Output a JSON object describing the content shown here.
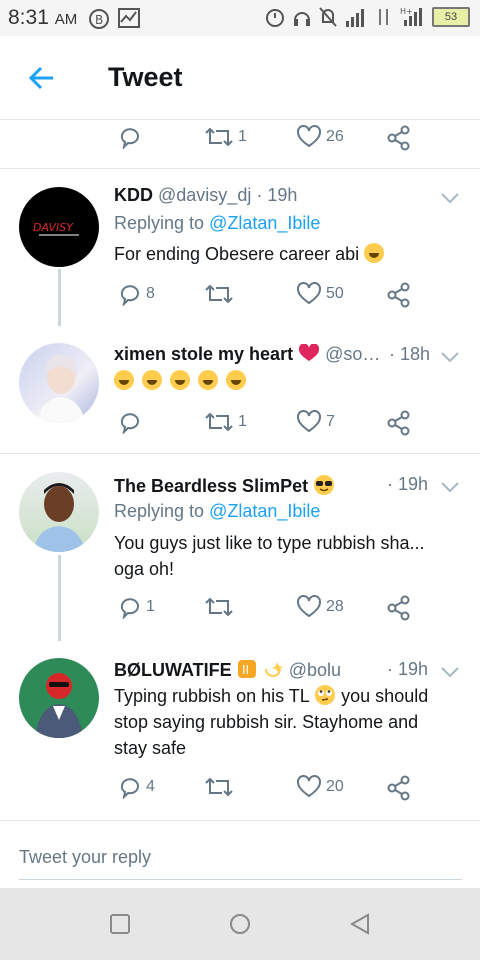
{
  "status_bar": {
    "time": "8:31",
    "ampm": "AM",
    "battery": "53"
  },
  "header": {
    "title": "Tweet"
  },
  "top_actions": {
    "retweets": "1",
    "likes": "26"
  },
  "tweets": [
    {
      "name": "KDD",
      "handle": "@davisy_dj",
      "time": "· 19h",
      "replying_label": "Replying to",
      "replying_to": "@Zlatan_Ibile",
      "text": "For ending Obesere career abi",
      "replies": "8",
      "retweets": "",
      "likes": "50"
    },
    {
      "name": "ximen stole my heart",
      "handle": "@so…",
      "time": "· 18h",
      "text": "",
      "replies": "",
      "retweets": "1",
      "likes": "7"
    },
    {
      "name": "The Beardless SlimPet",
      "handle": "@…",
      "time": "· 19h",
      "replying_label": "Replying to",
      "replying_to": "@Zlatan_Ibile",
      "text_line1": "You guys just like to type rubbish sha...",
      "text_line2": "oga oh!",
      "replies": "1",
      "retweets": "",
      "likes": "28"
    },
    {
      "name": "BØLUWATIFE",
      "handle": "@boluw…",
      "time": "· 19h",
      "text_line1a": "Typing rubbish on his TL",
      "text_line1b": "you should",
      "text_line2": "stop saying rubbish sir. Stayhome and",
      "text_line3": "stay safe",
      "replies": "4",
      "retweets": "",
      "likes": "20"
    }
  ],
  "reply_box": {
    "placeholder": "Tweet your reply"
  },
  "colors": {
    "accent": "#1da1f2",
    "muted": "#657786",
    "border": "#e1e8ed"
  },
  "icons": [
    "back-arrow-icon",
    "reply-icon",
    "retweet-icon",
    "like-icon",
    "share-icon",
    "chevron-down-icon",
    "square-nav-icon",
    "circle-nav-icon",
    "triangle-nav-icon"
  ]
}
